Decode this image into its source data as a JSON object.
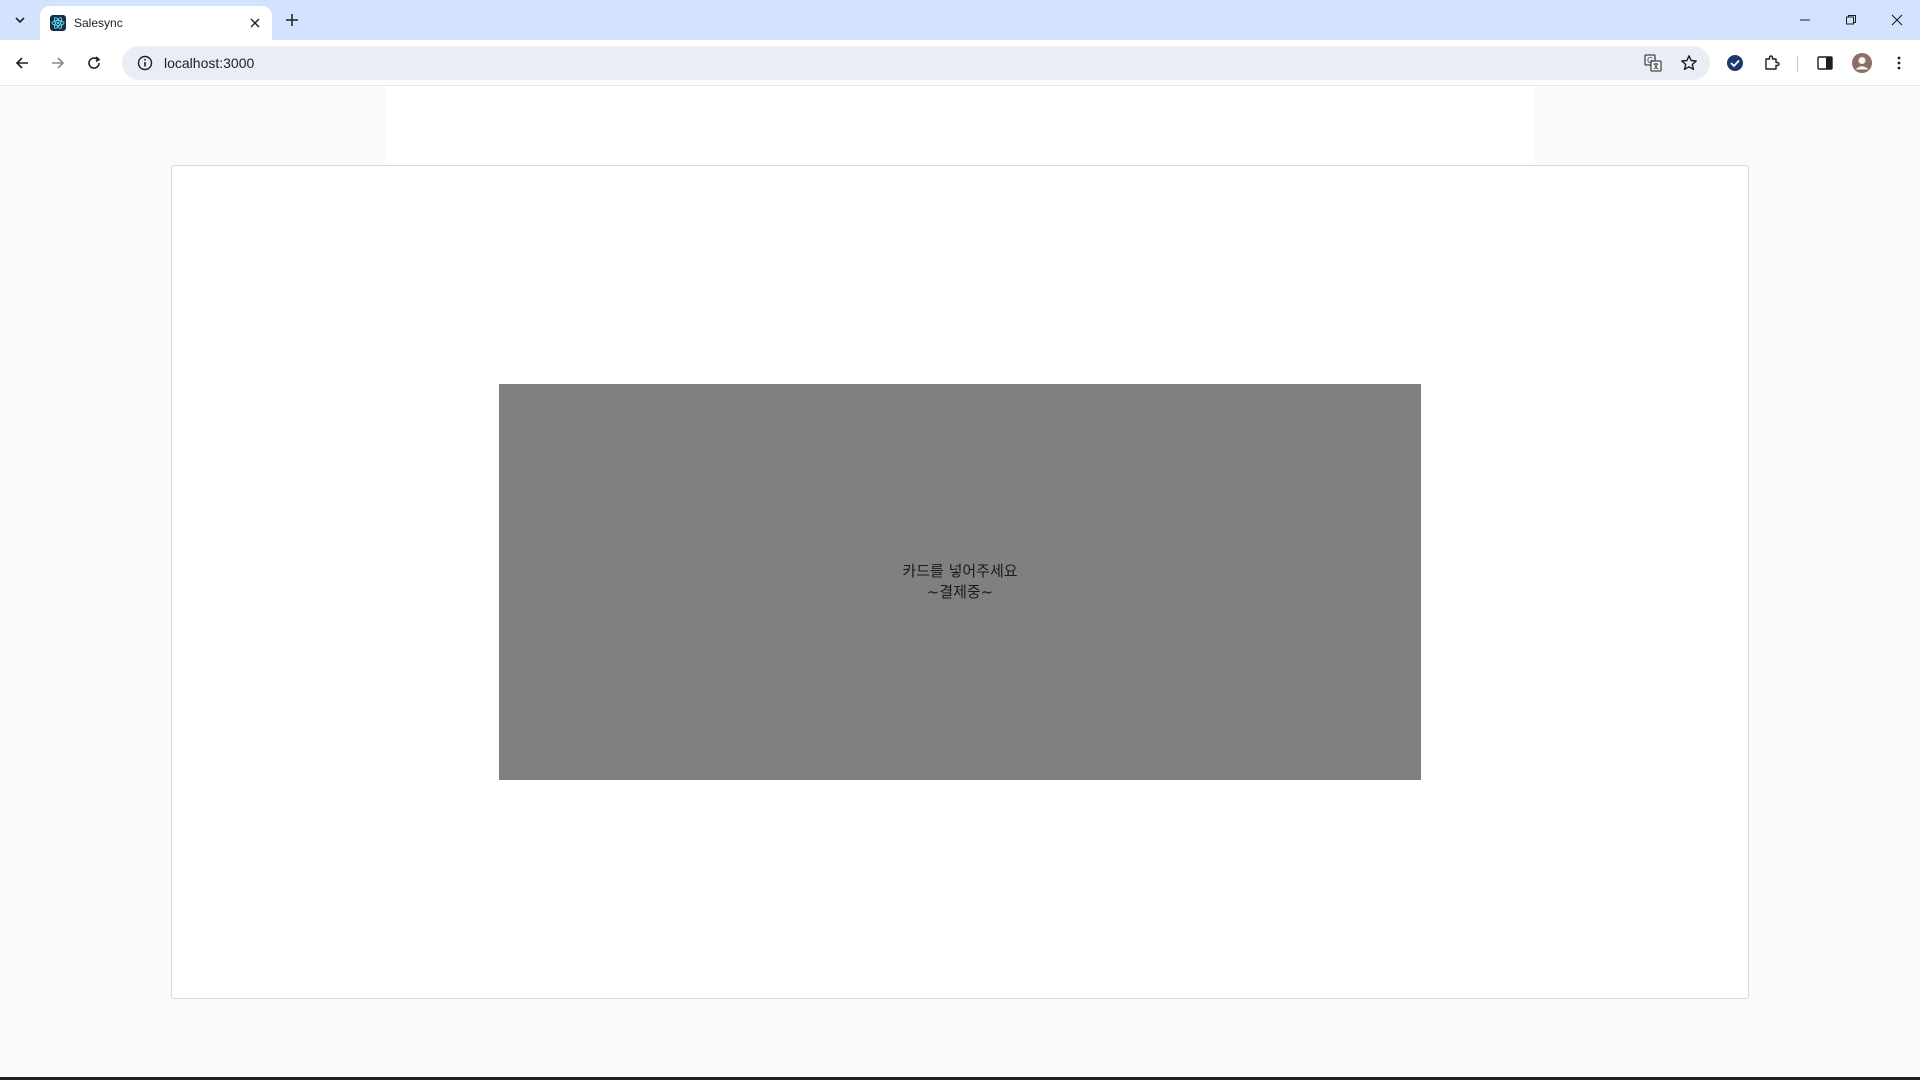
{
  "browser": {
    "tab_title": "Salesync",
    "url": "localhost:3000"
  },
  "overlay": {
    "line1": "카드를 넣어주세요",
    "line2": "~결제중~",
    "color": "#808080"
  },
  "colors": {
    "tabstrip": "#d3e3fd",
    "omnibox": "#e9eef6"
  }
}
